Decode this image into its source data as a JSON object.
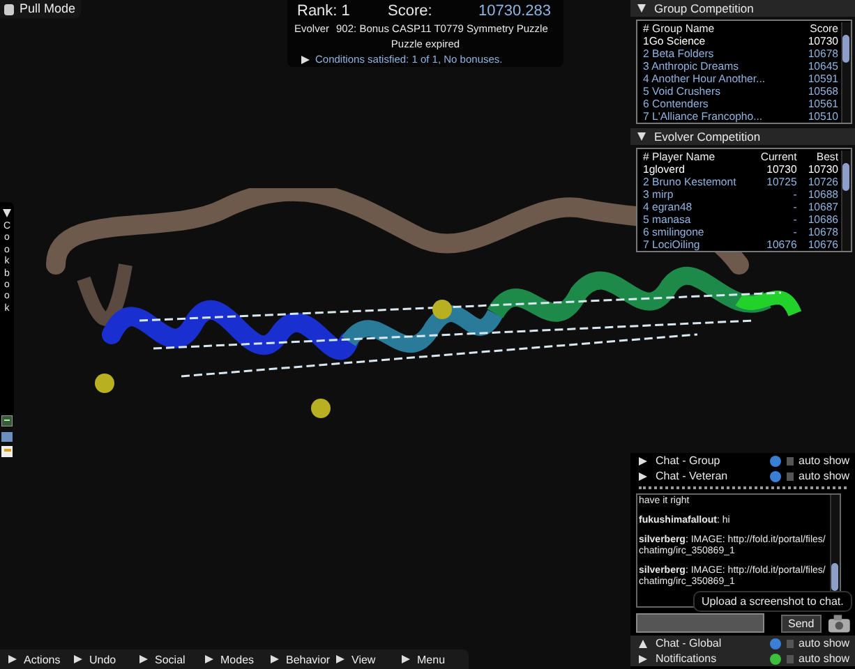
{
  "mode_button": {
    "label": "Pull Mode"
  },
  "score_panel": {
    "rank": "Rank: 1",
    "score_label": "Score:",
    "score": "10730.283",
    "puzzle_type": "Evolver",
    "puzzle_title": "902: Bonus CASP11 T0779 Symmetry Puzzle",
    "status": "Puzzle expired",
    "conditions": "Conditions satisfied: 1 of 1, No bonuses.",
    "conditions_expanded": false
  },
  "cookbook": {
    "title": "Cookbook",
    "expanded": true
  },
  "group_competition": {
    "title": "Group Competition",
    "expanded": true,
    "columns": [
      "# Group Name",
      "Score"
    ],
    "rows": [
      {
        "name": "1Go Science",
        "score": "10730",
        "selected": true
      },
      {
        "name": "2 Beta Folders",
        "score": "10678",
        "selected": false
      },
      {
        "name": "3 Anthropic Dreams",
        "score": "10645",
        "selected": false
      },
      {
        "name": "4 Another Hour Another...",
        "score": "10591",
        "selected": false
      },
      {
        "name": "5 Void Crushers",
        "score": "10568",
        "selected": false
      },
      {
        "name": "6 Contenders",
        "score": "10561",
        "selected": false
      },
      {
        "name": "7 L'Alliance Francopho...",
        "score": "10510",
        "selected": false
      }
    ]
  },
  "evolver_competition": {
    "title": "Evolver Competition",
    "expanded": true,
    "columns": [
      "# Player Name",
      "Current",
      "Best"
    ],
    "rows": [
      {
        "name": "1gloverd",
        "current": "10730",
        "best": "10730",
        "selected": true
      },
      {
        "name": "2 Bruno Kestemont",
        "current": "10725",
        "best": "10726",
        "selected": false
      },
      {
        "name": "3 mirp",
        "current": "-",
        "best": "10688",
        "selected": false
      },
      {
        "name": "4 egran48",
        "current": "-",
        "best": "10687",
        "selected": false
      },
      {
        "name": "5 manasa",
        "current": "-",
        "best": "10686",
        "selected": false
      },
      {
        "name": "6 smilingone",
        "current": "-",
        "best": "10678",
        "selected": false
      },
      {
        "name": "7 LociOiling",
        "current": "10676",
        "best": "10676",
        "selected": false
      }
    ]
  },
  "chat_top": [
    {
      "label": "Chat - Group",
      "expanded": false,
      "auto_show": false,
      "auto_show_label": "auto show",
      "color": "#3a7fd5"
    },
    {
      "label": "Chat - Veteran",
      "expanded": false,
      "auto_show": false,
      "auto_show_label": "auto show",
      "color": "#3a7fd5"
    }
  ],
  "chat_log": {
    "partial": "have it right",
    "messages": [
      {
        "text": "**fukushimafallout**: hi"
      },
      {
        "text": "**silverberg**: IMAGE: http://fold.it/portal/files/chatimg/irc_350869_1"
      },
      {
        "text": "**silverberg**: IMAGE: http://fold.it/portal/files/chatimg/irc_350869_1"
      }
    ]
  },
  "send_button": {
    "label": "Send"
  },
  "tooltip": "Upload a screenshot to chat.",
  "chat_bottom": [
    {
      "label": "Chat - Global",
      "expanded": true,
      "auto_show": false,
      "auto_show_label": "auto show",
      "color": "#3a7fd5"
    },
    {
      "label": "Notifications",
      "expanded": false,
      "auto_show": false,
      "auto_show_label": "auto show",
      "color": "#3cbf3c"
    }
  ],
  "menu_bar": [
    "Actions",
    "Undo",
    "Social",
    "Modes",
    "Behavior",
    "View",
    "Menu"
  ]
}
